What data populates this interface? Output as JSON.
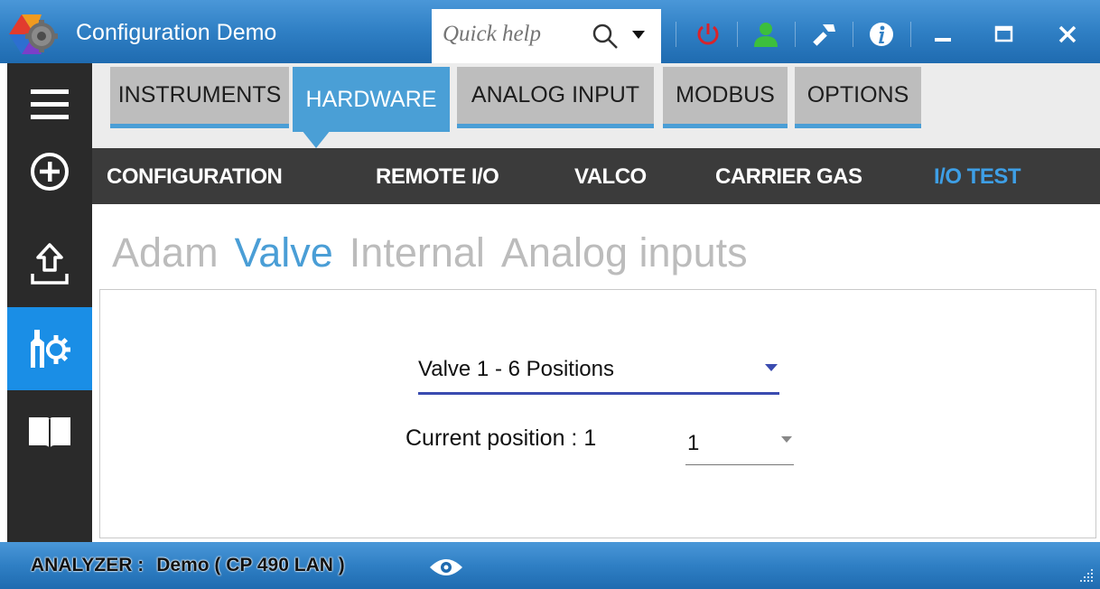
{
  "window": {
    "title": "Configuration Demo",
    "quick_help_placeholder": "Quick help",
    "controls": [
      "power-icon",
      "user-icon",
      "wrench-icon",
      "info-icon",
      "minimize-icon",
      "maximize-icon",
      "close-icon"
    ]
  },
  "rail": {
    "items": [
      "hamburger-menu-icon",
      "add-circle-icon",
      "upload-icon",
      "hardware-settings-icon",
      "book-icon"
    ],
    "active": "hardware-settings-icon"
  },
  "tabs": [
    {
      "label": "INSTRUMENTS",
      "active": false
    },
    {
      "label": "HARDWARE",
      "active": true
    },
    {
      "label": "ANALOG INPUT",
      "active": false
    },
    {
      "label": "MODBUS",
      "active": false
    },
    {
      "label": "OPTIONS",
      "active": false
    }
  ],
  "subnav": [
    {
      "label": "CONFIGURATION",
      "active": false
    },
    {
      "label": "REMOTE I/O",
      "active": false
    },
    {
      "label": "VALCO",
      "active": false
    },
    {
      "label": "CARRIER GAS",
      "active": false
    },
    {
      "label": "I/O TEST",
      "active": true
    }
  ],
  "pivots": [
    {
      "label": "Adam",
      "active": false
    },
    {
      "label": "Valve",
      "active": true
    },
    {
      "label": "Internal",
      "active": false
    },
    {
      "label": "Analog inputs",
      "active": false
    }
  ],
  "valve_panel": {
    "valve_select_value": "Valve 1 - 6 Positions",
    "current_position_label": "Current position : 1",
    "position_select_value": "1"
  },
  "status": {
    "label": "ANALYZER :",
    "value": "Demo ( CP 490 LAN )"
  },
  "colors": {
    "titlebar": "#2f7fc4",
    "accent": "#4a9fd6",
    "rail": "#2a2a2a",
    "rail_active": "#1a8ee6",
    "subnav": "#3b3b3b",
    "subnav_active": "#3e9fe6",
    "select_underline": "#3a4bb0"
  }
}
